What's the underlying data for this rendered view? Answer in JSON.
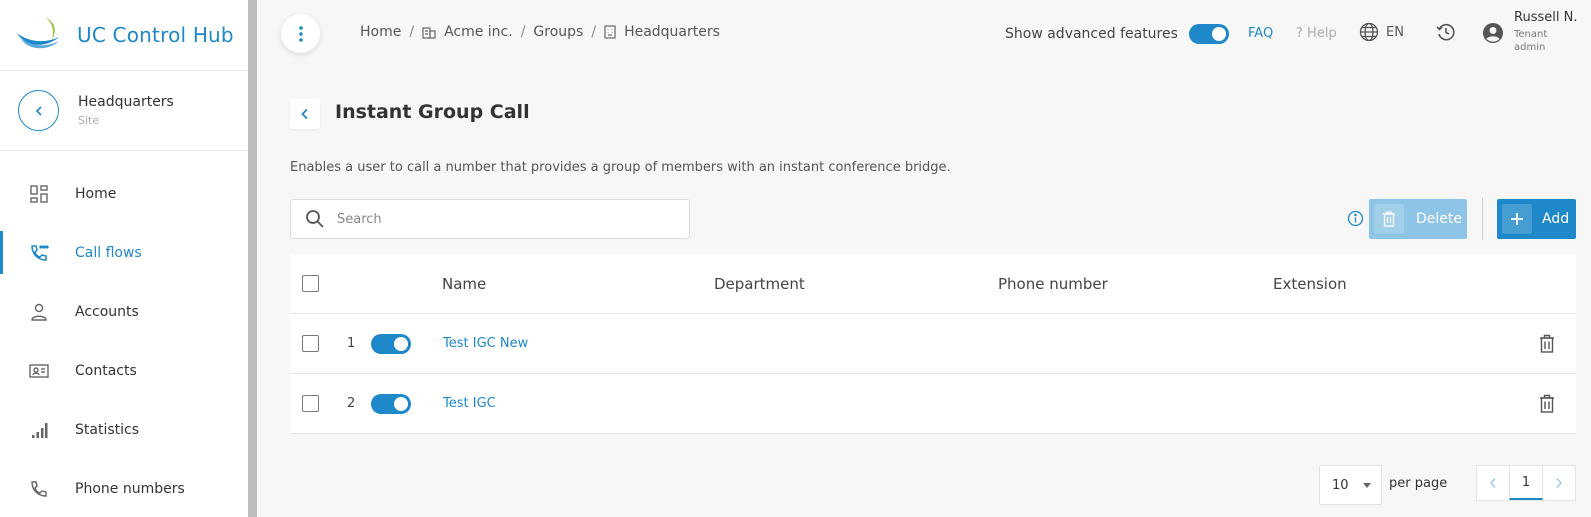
{
  "brand": {
    "title": "UC Control Hub"
  },
  "site": {
    "name": "Headquarters",
    "type": "Site"
  },
  "sidebar": {
    "items": [
      {
        "label": "Home",
        "icon": "dashboard-icon",
        "active": false
      },
      {
        "label": "Call flows",
        "icon": "call-flows-icon",
        "active": true
      },
      {
        "label": "Accounts",
        "icon": "person-icon",
        "active": false
      },
      {
        "label": "Contacts",
        "icon": "contact-card-icon",
        "active": false
      },
      {
        "label": "Statistics",
        "icon": "bar-chart-icon",
        "active": false
      },
      {
        "label": "Phone numbers",
        "icon": "phone-icon",
        "active": false
      }
    ]
  },
  "breadcrumb": [
    "Home",
    "Acme inc.",
    "Groups",
    "Headquarters"
  ],
  "header": {
    "advanced_label": "Show advanced features",
    "advanced_on": true,
    "faq": "FAQ",
    "help": "Help",
    "language": "EN",
    "user_name": "Russell N.",
    "user_role": "Tenant admin"
  },
  "page": {
    "title": "Instant Group Call",
    "description": "Enables a user to call a number that provides a group of members with an instant conference bridge."
  },
  "toolbar": {
    "search_placeholder": "Search",
    "delete_label": "Delete",
    "add_label": "Add"
  },
  "table": {
    "columns": [
      "Name",
      "Department",
      "Phone number",
      "Extension"
    ],
    "rows": [
      {
        "index": "1",
        "name": "Test IGC New",
        "department": "",
        "phone": "",
        "extension": "",
        "enabled": true
      },
      {
        "index": "2",
        "name": "Test IGC",
        "department": "",
        "phone": "",
        "extension": "",
        "enabled": true
      }
    ]
  },
  "pagination": {
    "per_page": "10",
    "per_page_label": "per page",
    "current_page": "1"
  },
  "colors": {
    "accent": "#1e88c8",
    "delete_disabled": "#8ec5e6"
  }
}
